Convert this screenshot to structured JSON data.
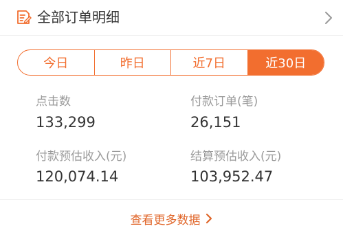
{
  "header": {
    "title": "全部订单明细",
    "icon": "edit-list-icon",
    "chevron": "chevron-right-icon"
  },
  "tabs": [
    {
      "label": "今日",
      "active": false
    },
    {
      "label": "昨日",
      "active": false
    },
    {
      "label": "近7日",
      "active": false
    },
    {
      "label": "近30日",
      "active": true
    }
  ],
  "stats": {
    "clicks": {
      "label": "点击数",
      "value": "133,299"
    },
    "paid_orders": {
      "label": "付款订单(笔)",
      "value": "26,151"
    },
    "paid_income": {
      "label": "付款预估收入(元)",
      "value": "120,074.14"
    },
    "settled_income": {
      "label": "结算预估收入(元)",
      "value": "103,952.47"
    }
  },
  "footer": {
    "more_label": "查看更多数据",
    "more_icon": "chevron-right-icon"
  },
  "colors": {
    "accent": "#f26e2f",
    "text": "#333333",
    "label": "#9a9a9a",
    "divider": "#efefef"
  }
}
